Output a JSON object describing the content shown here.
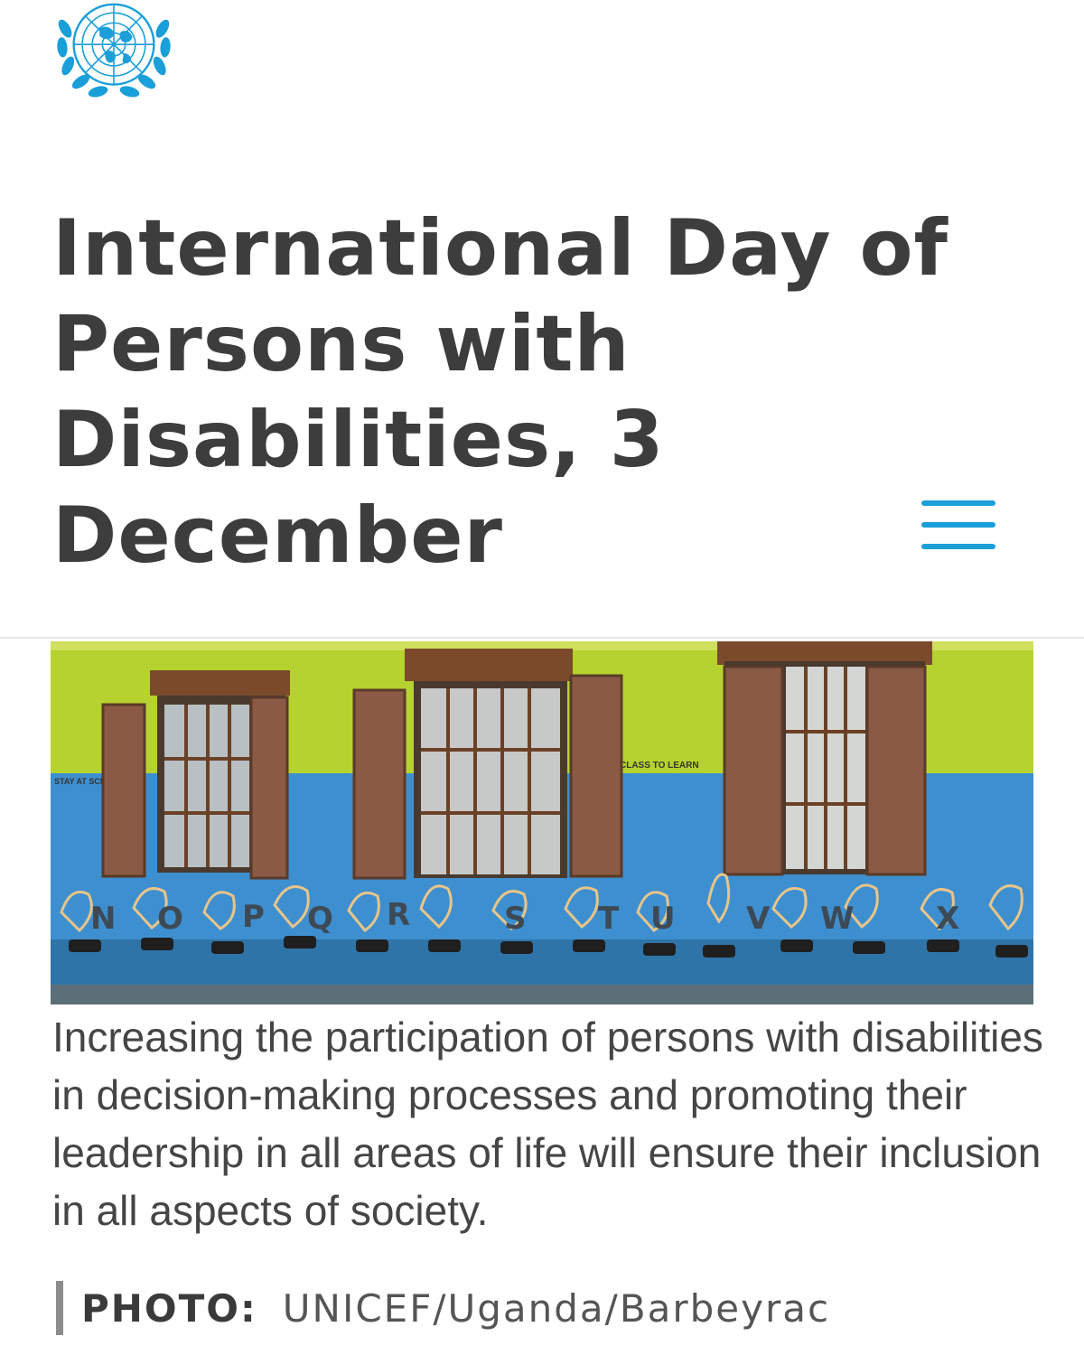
{
  "header": {
    "logo_icon": "un-emblem-icon",
    "brand_color": "#1a9fd9"
  },
  "page": {
    "title": "International Day of Persons with Disabilities, 3 December"
  },
  "nav": {
    "menu_icon": "hamburger-menu-icon"
  },
  "hero": {
    "wall_signs": [
      "STAY AT SCHOOL",
      "CLASS TO LEARN"
    ],
    "mural_letters": [
      "N",
      "O",
      "P",
      "Q",
      "R",
      "S",
      "T",
      "U",
      "V",
      "W",
      "X"
    ],
    "caption": "Increasing the participation of persons with disabilities in decision-making processes and promoting their leadership in all areas of life will ensure their inclusion in all aspects of society.",
    "credit_label": "PHOTO:",
    "credit_value": "UNICEF/Uganda/Barbeyrac"
  }
}
